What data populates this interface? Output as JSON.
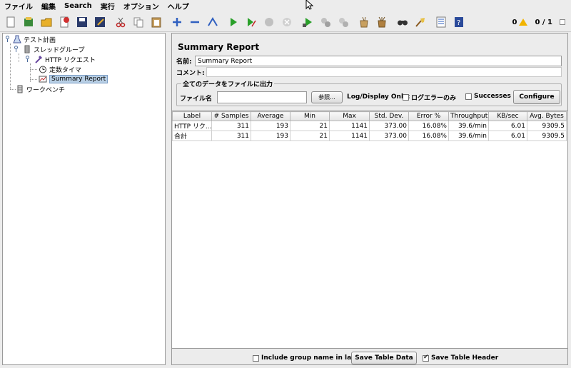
{
  "menu": [
    "ファイル",
    "編集",
    "Search",
    "実行",
    "オプション",
    "ヘルプ"
  ],
  "toolbar": {
    "icons": [
      "new-icon",
      "templates-icon",
      "open-icon",
      "close-icon",
      "save-icon",
      "save-as-icon",
      "cut-icon",
      "copy-icon",
      "paste-icon",
      "expand-icon",
      "collapse-icon",
      "toggle-icon",
      "start-icon",
      "start-no-pause-icon",
      "stop-icon",
      "shutdown-icon",
      "remote-start-icon",
      "remote-stop-icon",
      "remote-shutdown-icon",
      "clear-icon",
      "clear-all-icon",
      "search-icon",
      "reset-search-icon",
      "function-helper-icon",
      "help-icon"
    ],
    "warning_count": "0",
    "thread_count": "0 / 1"
  },
  "tree": {
    "test_plan": "テスト計画",
    "thread_group": "スレッドグループ",
    "http_request": "HTTP リクエスト",
    "constant_timer": "定数タイマ",
    "summary_report": "Summary Report",
    "workbench": "ワークベンチ"
  },
  "panel": {
    "title": "Summary Report",
    "name_label": "名前:",
    "name_value": "Summary Report",
    "comment_label": "コメント:",
    "file_section_legend": "全てのデータをファイルに出力",
    "file_label": "ファイル名",
    "browse_button": "参照...",
    "log_display_label": "Log/Display Only:",
    "errors_only_label": "ログエラーのみ",
    "successes_label": "Successes",
    "configure_button": "Configure"
  },
  "table": {
    "headers": [
      "Label",
      "# Samples",
      "Average",
      "Min",
      "Max",
      "Std. Dev.",
      "Error %",
      "Throughput",
      "KB/sec",
      "Avg. Bytes"
    ],
    "rows": [
      [
        "HTTP リク...",
        "311",
        "193",
        "21",
        "1141",
        "373.00",
        "16.08%",
        "39.6/min",
        "6.01",
        "9309.5"
      ],
      [
        "合計",
        "311",
        "193",
        "21",
        "1141",
        "373.00",
        "16.08%",
        "39.6/min",
        "6.01",
        "9309.5"
      ]
    ]
  },
  "footer": {
    "include_group_label": "Include group name in label?",
    "include_group_checked": false,
    "save_table_button": "Save Table Data",
    "save_header_label": "Save Table Header",
    "save_header_checked": true
  }
}
